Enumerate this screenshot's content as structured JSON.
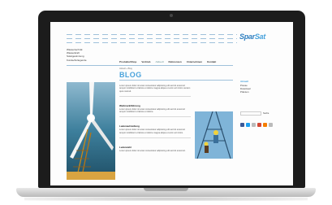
{
  "site": {
    "logo_prefix": "Spar",
    "logo_suffix": "Sat",
    "top_menu": [
      "Wassertechnik",
      "Wasserkraft",
      "Solargewinnung",
      "Kunde/Anliegende"
    ],
    "nav": [
      "Produkte/Shop",
      "Vertrieb",
      "Aktuell",
      "Referenzen",
      "Unternehmen",
      "Kontakt"
    ],
    "nav_active_index": 2,
    "breadcrumb": "Aktuell » Blog",
    "page_title": "BLOG",
    "posts": [
      {
        "title": "",
        "text": "Lorem ipsum dolor sit amet consectetur adipiscing elit sed do eiusmod tempor incididunt ut labore et dolore magna aliqua ut enim ad minim veniam quis nostrud."
      },
      {
        "title": "Weltmarktführung",
        "text": "Lorem ipsum dolor sit amet consectetur adipiscing elit sed do eiusmod tempor incididunt ut labore et dolore."
      },
      {
        "title": "Ladenaufstellung",
        "text": "Lorem ipsum dolor sit amet consectetur adipiscing elit sed do eiusmod tempor incididunt ut labore et dolore magna aliqua ut enim ad minim."
      },
      {
        "title": "Lederwahl",
        "text": "Lorem ipsum dolor sit amet consectetur adipiscing elit sed do eiusmod."
      }
    ],
    "sidebar": {
      "title": "Aktuell",
      "items": [
        "Presse",
        "Download",
        "Prämien"
      ],
      "search_button": "Suche"
    },
    "social_colors": [
      "#3b5998",
      "#1da1f2",
      "#bbbbbb",
      "#d34836",
      "#f57d00",
      "#bbbbbb"
    ]
  }
}
